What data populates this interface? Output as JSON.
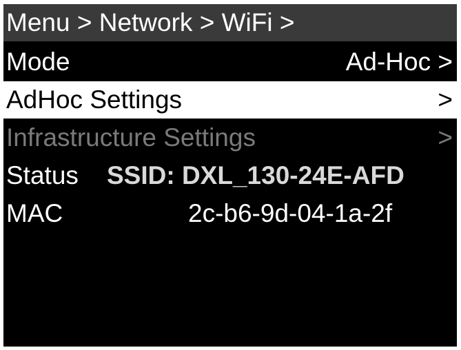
{
  "breadcrumb": "Menu > Network > WiFi >",
  "menu": {
    "mode": {
      "label": "Mode",
      "value": "Ad-Hoc >"
    },
    "adhoc_settings": {
      "label": "AdHoc Settings",
      "chevron": ">"
    },
    "infrastructure_settings": {
      "label": "Infrastructure Settings",
      "chevron": ">"
    }
  },
  "status": {
    "label": "Status",
    "ssid": "SSID: DXL_130-24E-AFD"
  },
  "mac": {
    "label": "MAC",
    "value": "2c-b6-9d-04-1a-2f"
  },
  "colors": {
    "background": "#000000",
    "header": "#3a3a3a",
    "selected_row": "#ffffff",
    "disabled_text": "#7a7a7a"
  }
}
